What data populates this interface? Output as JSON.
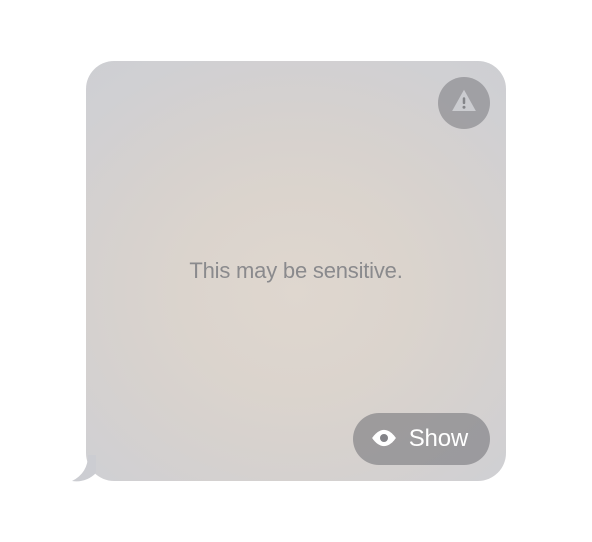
{
  "message": {
    "sensitive_label": "This may be sensitive.",
    "show_button_label": "Show"
  }
}
